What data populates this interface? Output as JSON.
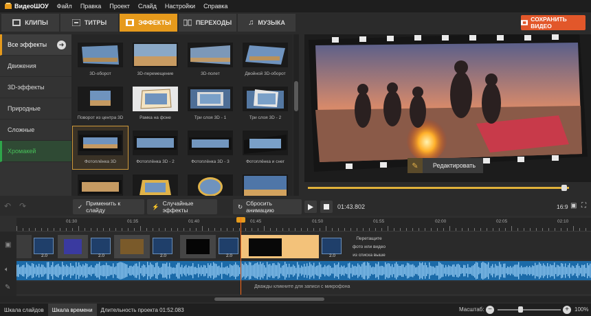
{
  "app": {
    "name": "ВидеоШОУ"
  },
  "menu": [
    "Файл",
    "Правка",
    "Проект",
    "Слайд",
    "Настройки",
    "Справка"
  ],
  "tabs": [
    {
      "label": "КЛИПЫ",
      "icon": "film-icon"
    },
    {
      "label": "ТИТРЫ",
      "icon": "title-icon"
    },
    {
      "label": "ЭФФЕКТЫ",
      "icon": "effects-icon",
      "active": true
    },
    {
      "label": "ПЕРЕХОДЫ",
      "icon": "transitions-icon"
    },
    {
      "label": "МУЗЫКА",
      "icon": "music-icon"
    }
  ],
  "save_button": "СОХРАНИТЬ ВИДЕО",
  "categories": [
    {
      "label": "Все эффекты"
    },
    {
      "label": "Движения"
    },
    {
      "label": "3D-эффекты"
    },
    {
      "label": "Природные"
    },
    {
      "label": "Сложные"
    },
    {
      "label": "Хромакей"
    }
  ],
  "effects": [
    {
      "label": "3D-оборот"
    },
    {
      "label": "3D-перемещение"
    },
    {
      "label": "3D-полет"
    },
    {
      "label": "Двойной 3D-оборот"
    },
    {
      "label": "Поворот из центра 3D"
    },
    {
      "label": "Рамка на фоне"
    },
    {
      "label": "Три слоя 3D - 1"
    },
    {
      "label": "Три слоя 3D - 2"
    },
    {
      "label": "Фотоплёнка 3D"
    },
    {
      "label": "Фотоплёнка 3D - 2"
    },
    {
      "label": "Фотоплёнка 3D - 3"
    },
    {
      "label": "Фотоплёнка и снег"
    },
    {
      "label": ""
    },
    {
      "label": ""
    },
    {
      "label": ""
    },
    {
      "label": ""
    }
  ],
  "preview": {
    "edit_button": "Редактировать",
    "progress": 0.98
  },
  "toolbar": {
    "apply": "Применить к слайду",
    "random": "Случайные эффекты",
    "reset": "Сбросить анимацию",
    "time": "01:43.802",
    "aspect": "16:9"
  },
  "ruler": [
    "01:30",
    "01:35",
    "01:40",
    "01:45",
    "01:50",
    "01:55",
    "02:00",
    "02:05",
    "02:10"
  ],
  "timeline": {
    "transition_labels": [
      "2.0",
      "2.0",
      "2.0",
      "2.0",
      "2.0",
      "2.0"
    ],
    "drop_hint": [
      "Перетащите",
      "фото или видео",
      "из списка выше"
    ],
    "mic_hint": "Дважды кликните для записи с микрофона"
  },
  "status": {
    "tab_slides": "Шкала слайдов",
    "tab_timeline": "Шкала времени",
    "duration": "Длительность проекта 01:52.083",
    "zoom_label": "Масштаб:",
    "zoom_value": "100%"
  },
  "colors": {
    "accent": "#e69a1c",
    "save": "#e2572a",
    "chroma": "#48c15a",
    "audio": "#1b6aa8"
  }
}
